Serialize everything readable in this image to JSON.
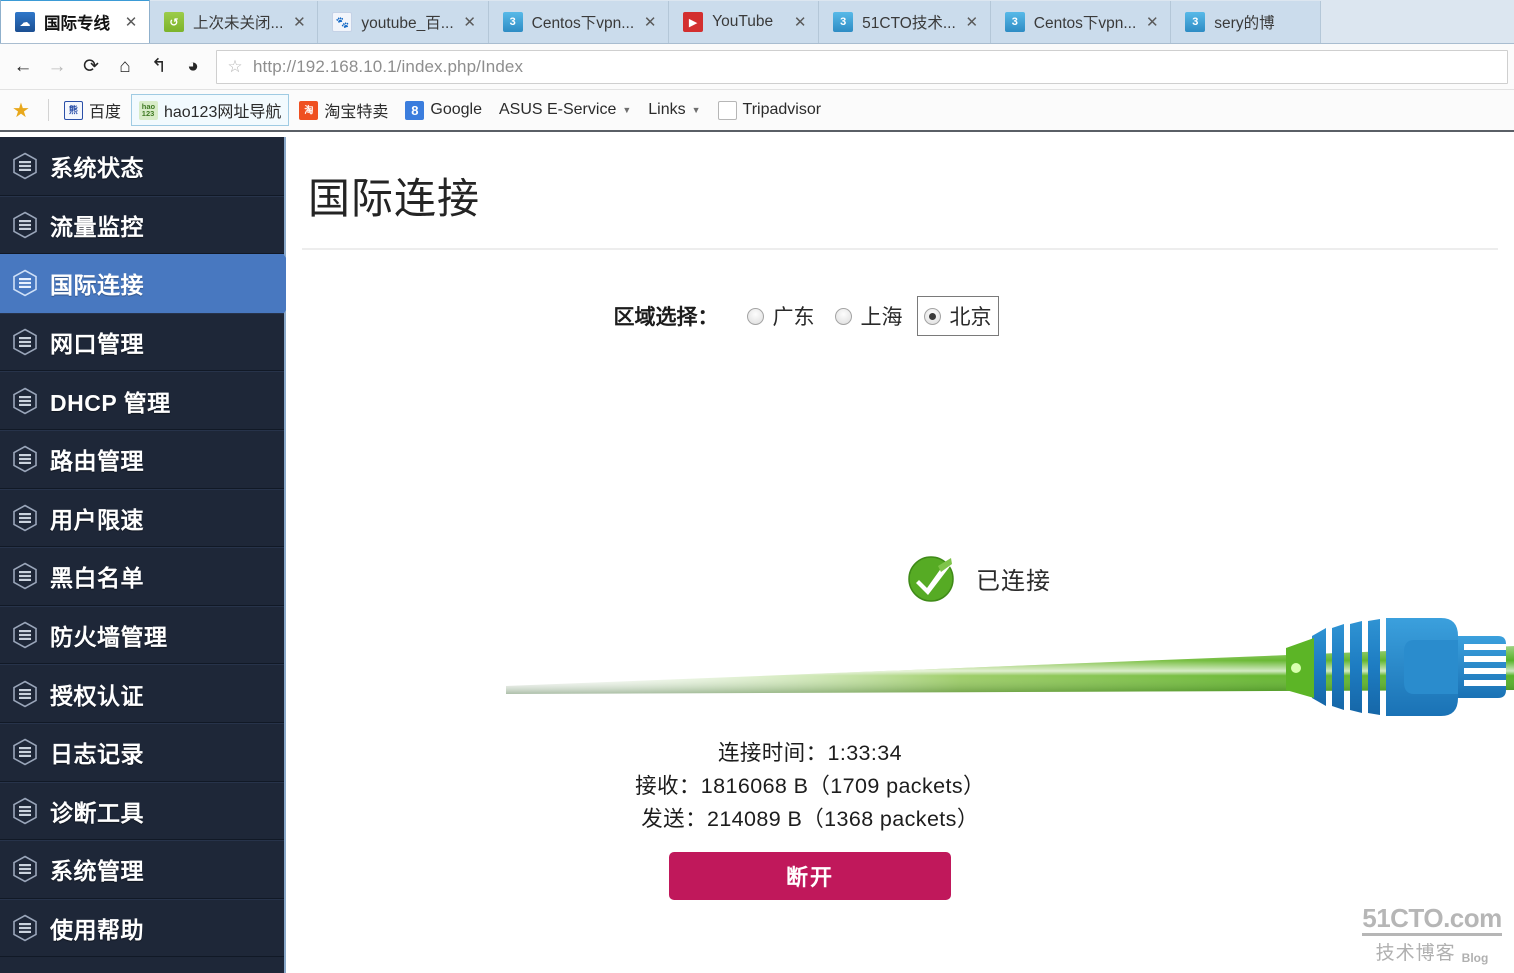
{
  "browser": {
    "tabs": [
      {
        "title": "国际专线",
        "favicon": "cloud-icon",
        "active": true,
        "close_label": "✕"
      },
      {
        "title": "上次未关闭...",
        "favicon": "restore-session-icon",
        "active": false,
        "close_label": "✕"
      },
      {
        "title": "youtube_百...",
        "favicon": "baidu-paw-icon",
        "active": false,
        "close_label": "✕"
      },
      {
        "title": "Centos下vpn...",
        "favicon": "blog-icon",
        "active": false,
        "close_label": "✕"
      },
      {
        "title": "YouTube",
        "favicon": "youtube-icon",
        "active": false,
        "close_label": "✕"
      },
      {
        "title": "51CTO技术...",
        "favicon": "blog-icon",
        "active": false,
        "close_label": "✕"
      },
      {
        "title": "Centos下vpn...",
        "favicon": "blog-icon",
        "active": false,
        "close_label": "✕"
      },
      {
        "title": "sery的博",
        "favicon": "blog-icon",
        "active": false,
        "close_label": ""
      }
    ],
    "nav": {
      "back_icon": "←",
      "forward_icon": "→",
      "reload_icon": "⟳",
      "home_icon": "⌂",
      "undo_icon": "↰",
      "history_icon": "◕",
      "star_icon": "☆",
      "url": "http://192.168.10.1/index.php/Index"
    },
    "bookmarks": {
      "star_icon": "★",
      "items": [
        {
          "label": "百度",
          "icon": "baidu-icon",
          "boxed": false
        },
        {
          "label": "hao123网址导航",
          "icon": "hao123-icon",
          "boxed": true
        },
        {
          "label": "淘宝特卖",
          "icon": "taobao-icon",
          "boxed": false
        },
        {
          "label": "Google",
          "icon": "google-icon",
          "boxed": false
        },
        {
          "label": "ASUS E-Service",
          "icon": "",
          "boxed": false,
          "caret": true
        },
        {
          "label": "Links",
          "icon": "",
          "boxed": false,
          "caret": true
        },
        {
          "label": "Tripadvisor",
          "icon": "document-icon",
          "boxed": false
        }
      ]
    }
  },
  "sidebar": {
    "items": [
      {
        "label": "系统状态",
        "icon": "hex-menu-icon",
        "active": false
      },
      {
        "label": "流量监控",
        "icon": "hex-menu-icon",
        "active": false
      },
      {
        "label": "国际连接",
        "icon": "hex-menu-icon",
        "active": true
      },
      {
        "label": "网口管理",
        "icon": "hex-menu-icon",
        "active": false
      },
      {
        "label": "DHCP 管理",
        "icon": "hex-menu-icon",
        "active": false
      },
      {
        "label": "路由管理",
        "icon": "hex-menu-icon",
        "active": false
      },
      {
        "label": "用户限速",
        "icon": "hex-menu-icon",
        "active": false
      },
      {
        "label": "黑白名单",
        "icon": "hex-menu-icon",
        "active": false
      },
      {
        "label": "防火墙管理",
        "icon": "hex-menu-icon",
        "active": false
      },
      {
        "label": "授权认证",
        "icon": "hex-menu-icon",
        "active": false
      },
      {
        "label": "日志记录",
        "icon": "hex-menu-icon",
        "active": false
      },
      {
        "label": "诊断工具",
        "icon": "hex-menu-icon",
        "active": false
      },
      {
        "label": "系统管理",
        "icon": "hex-menu-icon",
        "active": false
      },
      {
        "label": "使用帮助",
        "icon": "hex-menu-icon",
        "active": false
      }
    ]
  },
  "main": {
    "page_title": "国际连接",
    "region": {
      "label": "区域选择：",
      "options": [
        {
          "label": "广东",
          "selected": false,
          "focused": false
        },
        {
          "label": "上海",
          "selected": false,
          "focused": false
        },
        {
          "label": "北京",
          "selected": true,
          "focused": true
        }
      ]
    },
    "connection": {
      "status_icon": "green-check-icon",
      "status_text": "已连接",
      "cable_icon": "green-network-cable-icon",
      "plug_icon": "rj45-plug-icon",
      "uptime_line": "连接时间：1:33:34",
      "received_line": "接收：1816068 B（1709 packets）",
      "sent_line": "发送：214089 B（1368 packets）"
    },
    "disconnect_label": "断开"
  },
  "watermark": {
    "top": "51CTO.com",
    "cn": "技术博客",
    "blog": "Blog"
  },
  "colors": {
    "sidebar_bg": "#1e2738",
    "sidebar_active": "#4878c0",
    "disconnect_btn": "#c0185b",
    "cable_green": "#52b023",
    "plug_blue": "#1f7ec4",
    "check_green": "#4ba520"
  }
}
